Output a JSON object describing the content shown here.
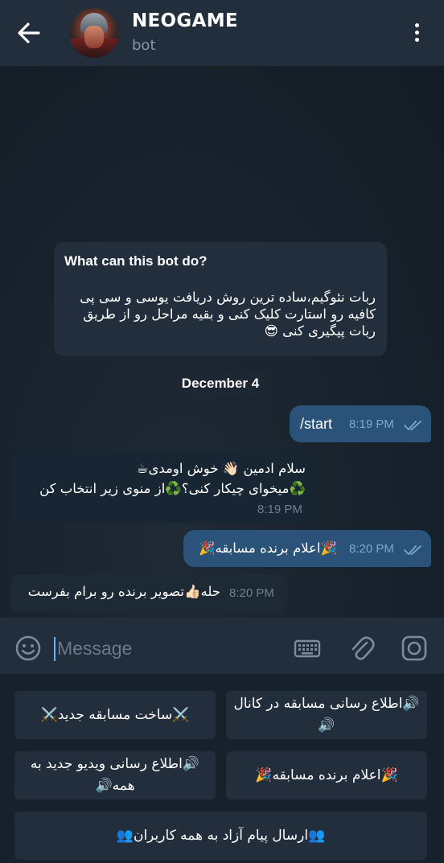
{
  "header": {
    "title": "NEOGAME",
    "subtitle": "bot",
    "back_icon": "arrow-left-icon",
    "menu_icon": "kebab-menu-icon"
  },
  "intro": {
    "title": "What can this bot do?",
    "text": "ربات نئوگیم،ساده ترین روش دریافت یوسی و سی پی کافیه رو استارت کلیک کنی و بقیه مراحل رو از طریق ربات پیگیری کنی 😎"
  },
  "date_label": "December 4",
  "messages": [
    {
      "dir": "out",
      "lines": [
        "/start"
      ],
      "time": "8:19 PM"
    },
    {
      "dir": "in",
      "lines": [
        "سلام ادمین 👋🏻 خوش اومدی☕",
        "♻️میخوای چیکار کنی؟♻️از منوی زیر انتخاب کن"
      ],
      "time": "8:19 PM"
    },
    {
      "dir": "out",
      "lines": [
        "🎉اعلام برنده مسابقه🎉"
      ],
      "time": "8:20 PM"
    },
    {
      "dir": "in",
      "lines": [
        "حله👍🏻تصویر برنده رو برام بفرست"
      ],
      "time": "8:20 PM"
    }
  ],
  "input": {
    "placeholder": "Message",
    "emoji_icon": "emoji-icon",
    "keyboard_icon": "bot-keyboard-icon",
    "attach_icon": "paperclip-icon",
    "camera_icon": "camera-icon"
  },
  "keyboard": {
    "buttons": [
      "🔊اطلاع رسانی مسابقه در کانال🔊",
      "⚔️ساخت مسابقه جدید⚔️",
      "🎉اعلام برنده مسابقه🎉",
      "🔊اطلاع رسانی ویدیو جدید به همه🔊",
      "👥ارسال پیام آزاد به همه کاربران👥"
    ]
  },
  "colors": {
    "background": "#17212b",
    "header": "#232e3c",
    "outgoing_bubble": "#2b5278",
    "incoming_bubble": "#182533",
    "accent": "#5eb5f7"
  }
}
